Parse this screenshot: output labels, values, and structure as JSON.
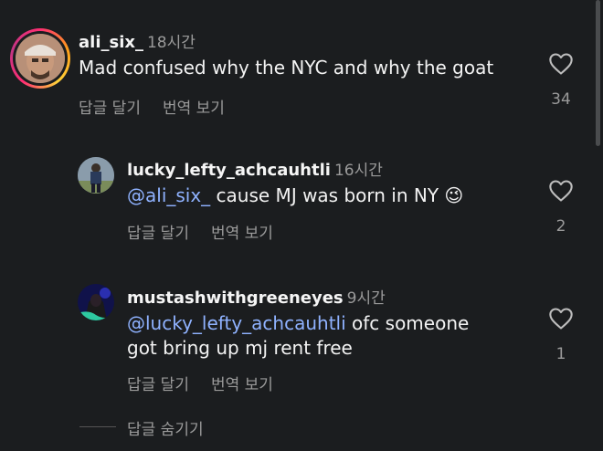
{
  "comments": [
    {
      "username": "ali_six_",
      "time": "18시간",
      "mention": "",
      "text": "Mad confused why the NYC and why the goat",
      "reply_label": "답글 달기",
      "translate_label": "번역 보기",
      "likes": "34"
    },
    {
      "username": "lucky_lefty_achcauhtli",
      "time": "16시간",
      "mention": "@ali_six_",
      "text": "cause MJ was born in NY 😉",
      "reply_label": "답글 달기",
      "translate_label": "번역 보기",
      "likes": "2"
    },
    {
      "username": "mustashwithgreeneyes",
      "time": "9시간",
      "mention": "@lucky_lefty_achcauhtli",
      "text_line1": "ofc someone",
      "text_line2": "got bring up mj rent free",
      "reply_label": "답글 달기",
      "translate_label": "번역 보기",
      "likes": "1"
    }
  ],
  "hide_replies_label": "답글 숨기기",
  "colors": {
    "background": "#1b1d1f",
    "mention": "#8fb2ff",
    "muted": "#9a9a9a"
  }
}
